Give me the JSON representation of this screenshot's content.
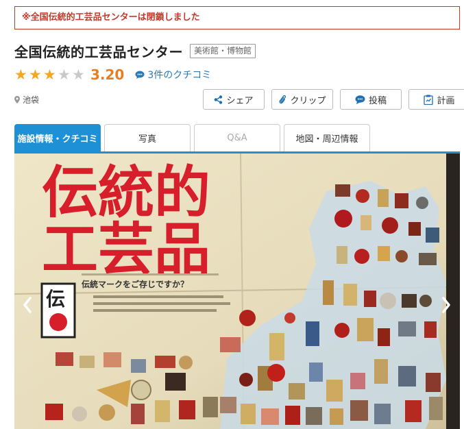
{
  "notice": "※全国伝統的工芸品センターは閉鎖しました",
  "header": {
    "title": "全国伝統的工芸品センター",
    "category": "美術館・博物館"
  },
  "rating": {
    "stars_filled": 3,
    "stars_total": 5,
    "score": "3.20",
    "reviews_label": "3件のクチコミ"
  },
  "location": "池袋",
  "actions": {
    "share": "シェア",
    "clip": "クリップ",
    "post": "投稿",
    "plan": "計画"
  },
  "tabs": [
    {
      "label": "施設情報・クチコミ",
      "state": "active"
    },
    {
      "label": "写真",
      "state": "normal"
    },
    {
      "label": "Q&A",
      "state": "disabled"
    },
    {
      "label": "地図・周辺情報",
      "state": "normal"
    }
  ],
  "photo": {
    "poster_title_line1": "伝統的",
    "poster_title_line2": "工芸品",
    "poster_subtitle": "伝統マークをご存じですか？",
    "mark_glyph": "伝"
  },
  "colors": {
    "accent": "#1e90d6",
    "notice": "#c0392b",
    "star": "#f5a623",
    "score": "#e67e22",
    "link": "#2a7ab9"
  },
  "icons": {
    "prev": "chevron-left-icon",
    "next": "chevron-right-icon"
  }
}
